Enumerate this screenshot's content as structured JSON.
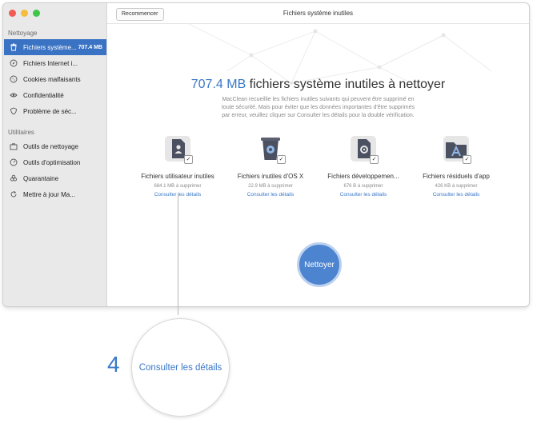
{
  "window": {
    "title": "Fichiers système inutiles",
    "restart_button": "Recommencer"
  },
  "sidebar": {
    "section_cleaning": "Nettoyage",
    "cleaning_items": [
      {
        "label": "Fichiers système...",
        "size": "707.4 MB",
        "icon": "trash-icon",
        "active": true
      },
      {
        "label": "Fichiers Internet i...",
        "icon": "compass-icon"
      },
      {
        "label": "Cookies malfaisants",
        "icon": "cookie-icon"
      },
      {
        "label": "Confidentialité",
        "icon": "eye-icon"
      },
      {
        "label": "Problème de séc...",
        "icon": "shield-icon"
      }
    ],
    "section_utilities": "Utilitaires",
    "utility_items": [
      {
        "label": "Outils de nettoyage",
        "icon": "briefcase-icon"
      },
      {
        "label": "Outils d'optimisation",
        "icon": "gauge-icon"
      },
      {
        "label": "Quarantaine",
        "icon": "biohazard-icon"
      },
      {
        "label": "Mettre à jour Ma...",
        "icon": "refresh-icon"
      }
    ]
  },
  "summary": {
    "amount": "707.4 MB",
    "headline_rest": " fichiers système inutiles à nettoyer",
    "description": "MacClean recueillie les fichiers inutiles suivants qui peuvent être supprimé en toute sécurité. Mais pour éviter que les données importantes d'être supprimés par erreur, veuillez cliquer sur Consulter les détails pour la double vérification."
  },
  "categories": [
    {
      "name": "Fichiers utilisateur inutiles",
      "size": "684.1 MB à supprimer",
      "link": "Consulter les détails",
      "icon": "user-file-icon",
      "checked": "✓"
    },
    {
      "name": "Fichiers inutiles d'OS X",
      "size": "22.9 MB à supprimer",
      "link": "Consulter les détails",
      "icon": "os-trash-icon",
      "checked": "✓"
    },
    {
      "name": "Fichiers développemen...",
      "size": "676 B à supprimer",
      "link": "Consulter les détails",
      "icon": "gear-file-icon",
      "checked": "✓"
    },
    {
      "name": "Fichiers résiduels d'app",
      "size": "426 KB à supprimer",
      "link": "Consulter les détails",
      "icon": "app-folder-icon",
      "checked": "✓"
    }
  ],
  "clean_button": "Nettoyer",
  "callout": {
    "step": "4",
    "text": "Consulter les détails"
  },
  "colors": {
    "accent": "#3a78c7",
    "sidebar_active": "#3b73c4",
    "clean_button": "#4d84cf"
  }
}
